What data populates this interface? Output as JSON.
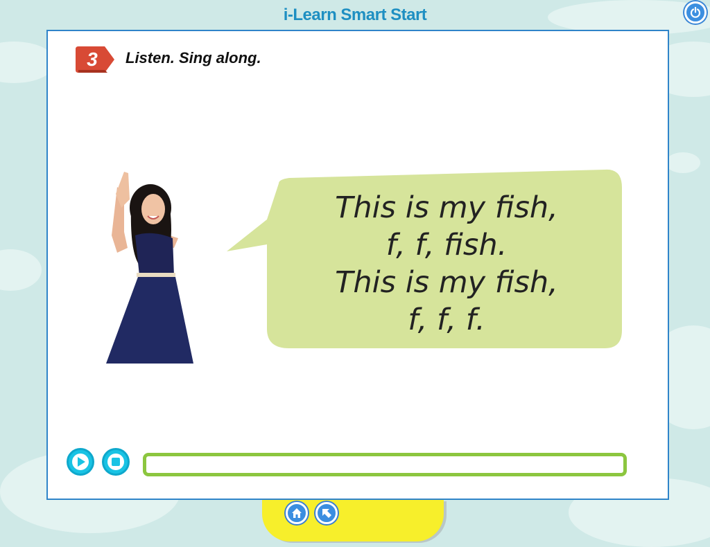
{
  "app": {
    "title": "i-Learn Smart Start"
  },
  "exercise": {
    "number": "3",
    "instruction": "Listen. Sing along."
  },
  "lyrics": [
    "This is my fish,",
    "f, f, fish.",
    "This is my fish,",
    "f, f, f."
  ],
  "player": {
    "progress": 0
  },
  "icons": {
    "power": "power-icon",
    "play": "play-icon",
    "stop": "stop-icon",
    "home": "home-icon",
    "back": "arrow-up-left-icon"
  },
  "colors": {
    "title": "#1e8fc2",
    "badge": "#d84a35",
    "bubble": "#d6e49b",
    "progress_border": "#8cc63f",
    "player_button": "#19c3e4",
    "tray": "#f7ef2b"
  }
}
